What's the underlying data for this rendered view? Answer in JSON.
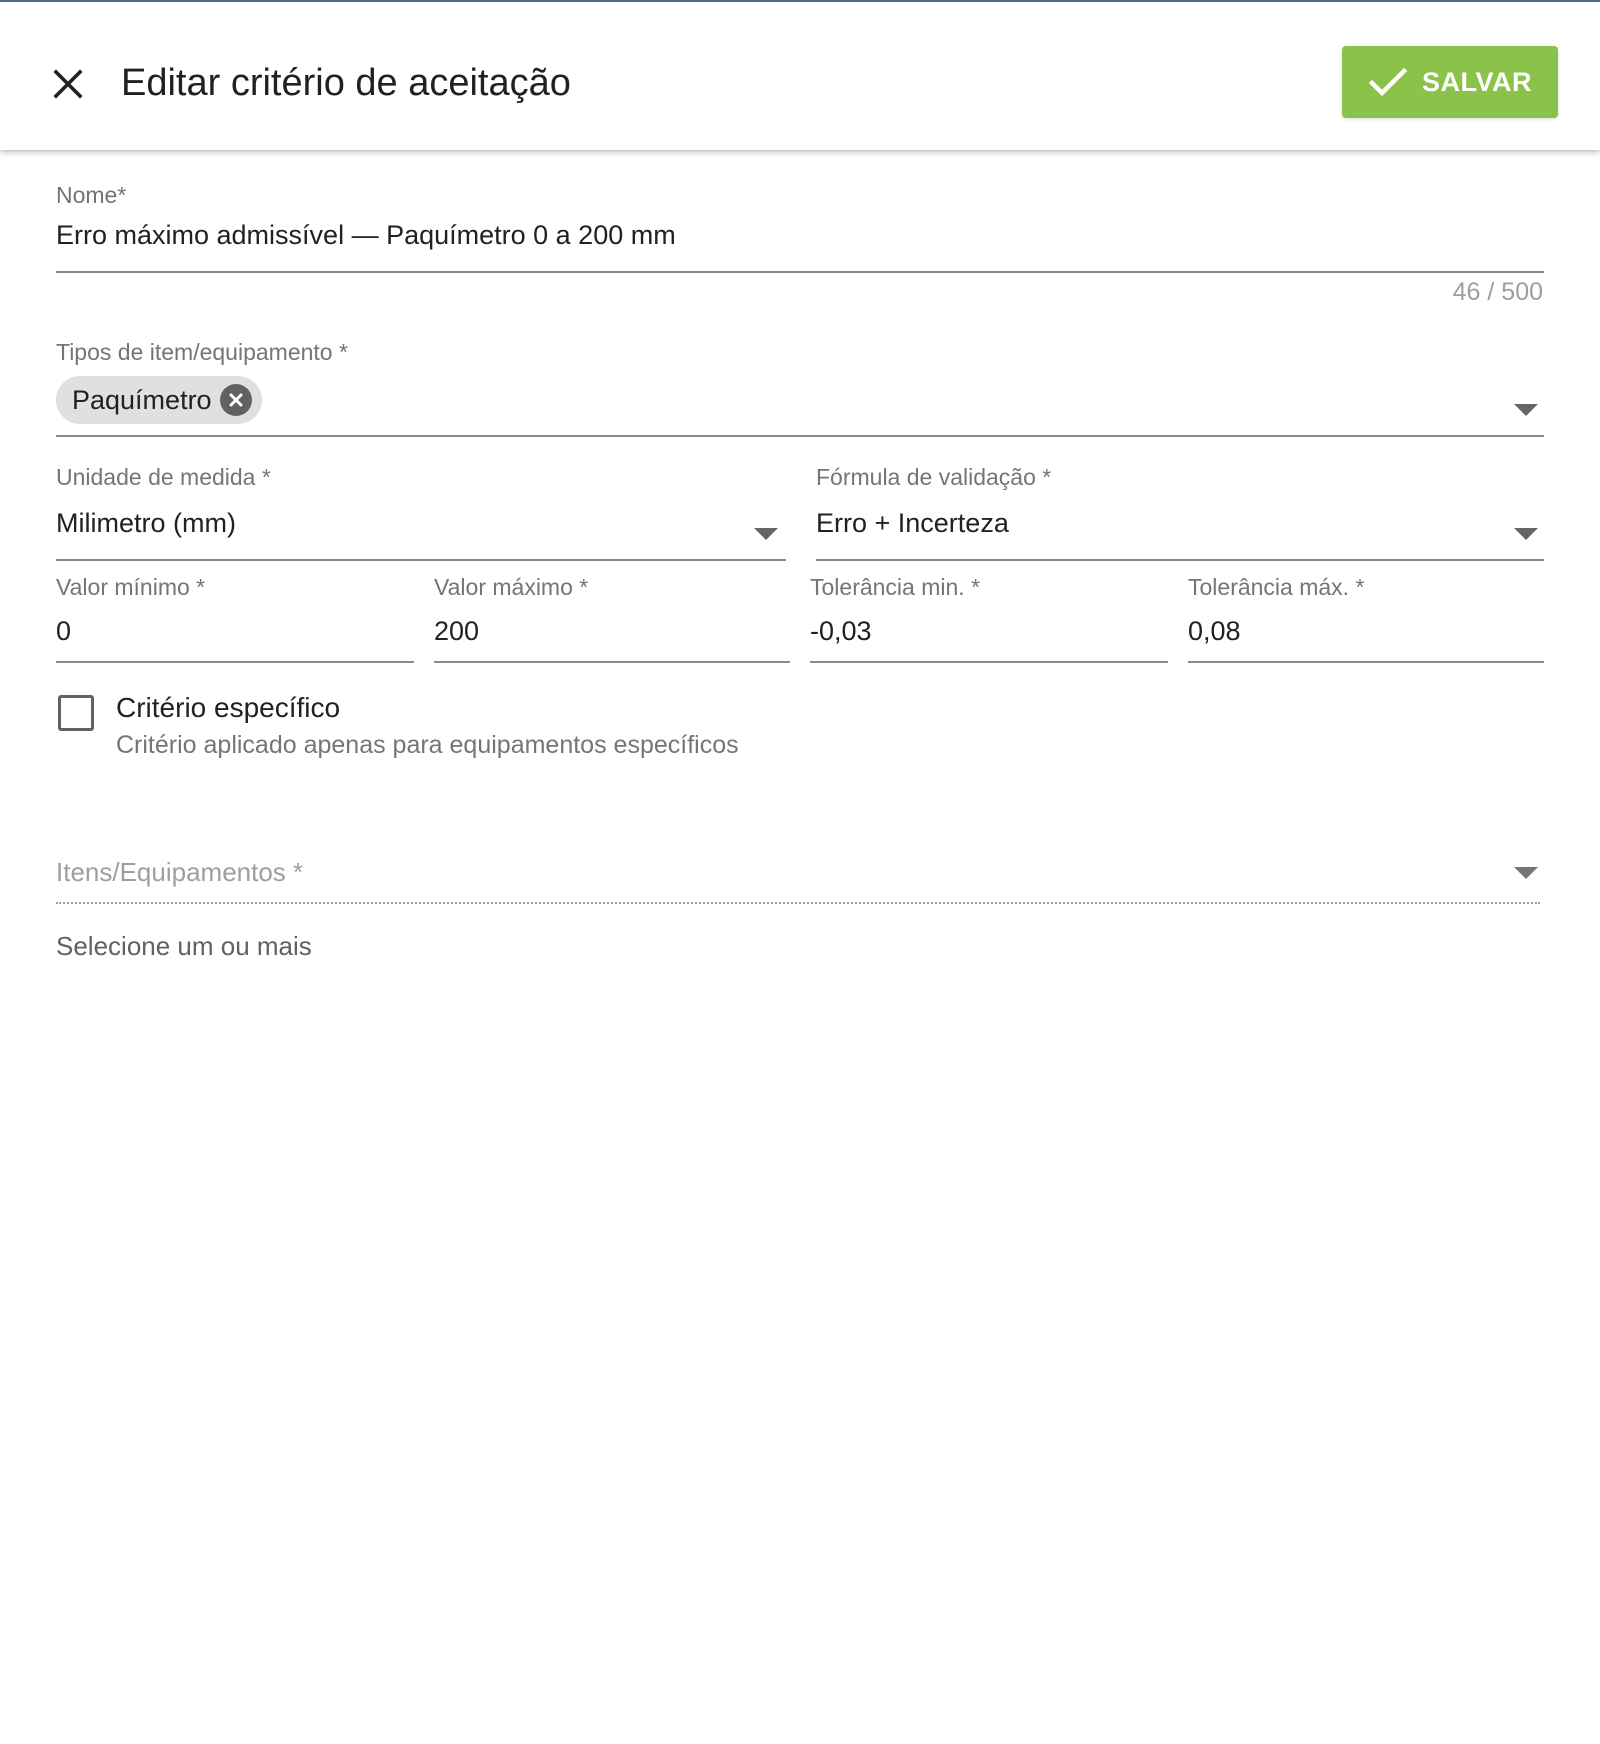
{
  "header": {
    "title": "Editar critério de aceitação",
    "save_label": "SALVAR",
    "close_icon": "close-icon",
    "save_icon": "check-icon",
    "accent_color": "#8bc34a"
  },
  "form": {
    "nome": {
      "label": "Nome*",
      "value": "Erro máximo admissível — Paquímetro 0 a 200 mm",
      "counter": "46 / 500"
    },
    "tipos": {
      "label": "Tipos de item/equipamento *",
      "chips": [
        "Paquímetro"
      ]
    },
    "unidade": {
      "label": "Unidade de medida *",
      "value": "Milimetro (mm)"
    },
    "formula": {
      "label": "Fórmula de validação *",
      "value": "Erro + Incerteza"
    },
    "valor_minimo": {
      "label": "Valor mínimo *",
      "value": "0"
    },
    "valor_maximo": {
      "label": "Valor máximo *",
      "value": "200"
    },
    "tolerancia_min": {
      "label": "Tolerância min. *",
      "value": "-0,03"
    },
    "tolerancia_max": {
      "label": "Tolerância máx. *",
      "value": "0,08"
    },
    "criterio_especifico": {
      "label": "Critério específico",
      "hint": "Critério aplicado apenas para equipamentos específicos",
      "checked": false
    },
    "itens": {
      "label": "Itens/Equipamentos *",
      "hint": "Selecione um ou mais"
    }
  }
}
